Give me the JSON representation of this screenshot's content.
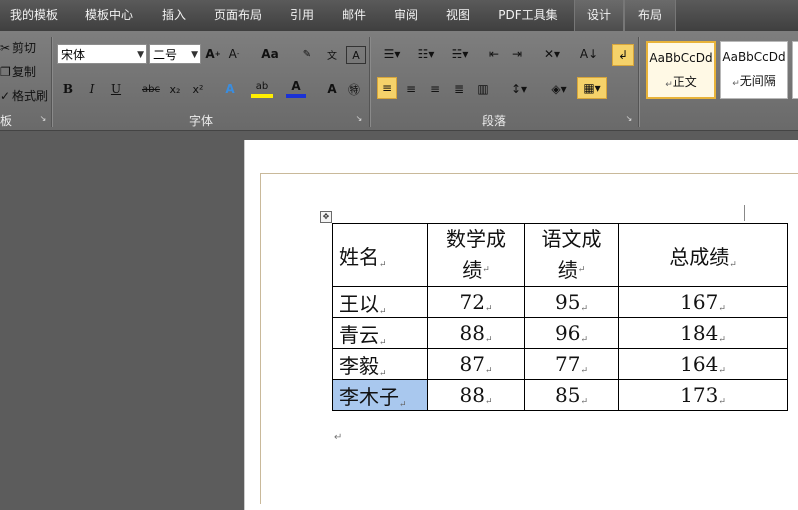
{
  "tabs": [
    "我的模板",
    "模板中心",
    "插入",
    "页面布局",
    "引用",
    "邮件",
    "审阅",
    "视图",
    "PDF工具集",
    "设计",
    "布局"
  ],
  "clipboard": {
    "cut": "剪切",
    "copy": "复制",
    "format_painter": "格式刷",
    "group": "板"
  },
  "font": {
    "name": "宋体",
    "size": "二号",
    "group": "字体"
  },
  "paragraph": {
    "group": "段落"
  },
  "styles": [
    {
      "sample": "AaBbCcDd",
      "name": "正文"
    },
    {
      "sample": "AaBbCcDd",
      "name": "无间隔"
    }
  ],
  "table": {
    "headers": [
      "姓名",
      "数学成绩",
      "语文成绩",
      "总成绩"
    ],
    "header_lines": [
      [
        "姓名"
      ],
      [
        "数学成",
        "绩"
      ],
      [
        "语文成",
        "绩"
      ],
      [
        "总成绩"
      ]
    ],
    "rows": [
      [
        "王以",
        "72",
        "95",
        "167"
      ],
      [
        "青云",
        "88",
        "96",
        "184"
      ],
      [
        "李毅",
        "87",
        "77",
        "164"
      ],
      [
        "李木子",
        "88",
        "85",
        "173"
      ]
    ]
  },
  "marks": {
    "para": "↵",
    "cell": "↵"
  }
}
